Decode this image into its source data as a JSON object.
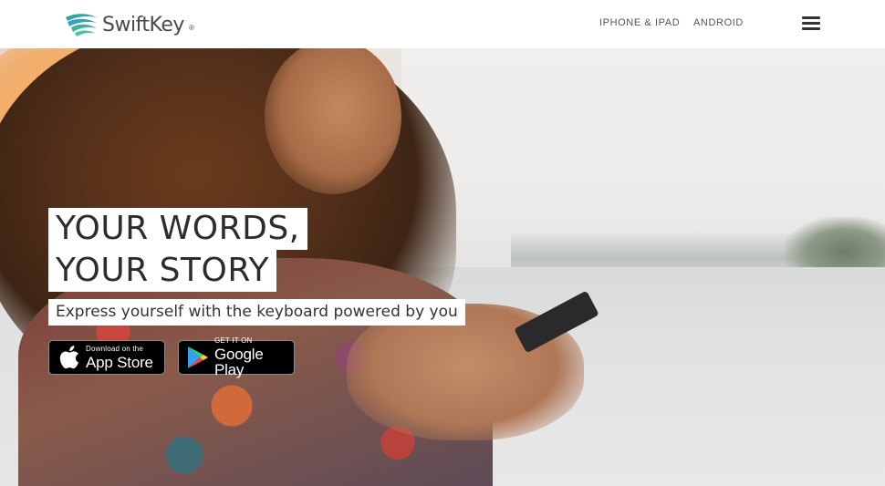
{
  "header": {
    "logo_text": "SwiftKey",
    "logo_reg": "®",
    "nav": [
      {
        "label": "IPHONE & IPAD"
      },
      {
        "label": "ANDROID"
      }
    ],
    "menu_icon": "hamburger-menu-icon"
  },
  "hero": {
    "headline_line1": "YOUR WORDS,",
    "headline_line2": "YOUR STORY",
    "subtitle": "Express yourself with the keyboard powered by you"
  },
  "badges": {
    "apple": {
      "small": "Download on the",
      "big": "App Store",
      "icon": "apple-icon"
    },
    "google": {
      "small": "GET IT ON",
      "big": "Google Play",
      "icon": "google-play-icon"
    }
  },
  "colors": {
    "brand_teal": "#26a69a",
    "brand_blue": "#3b8fc4",
    "text_dark": "#2d2d2d",
    "badge_bg": "#000000"
  }
}
